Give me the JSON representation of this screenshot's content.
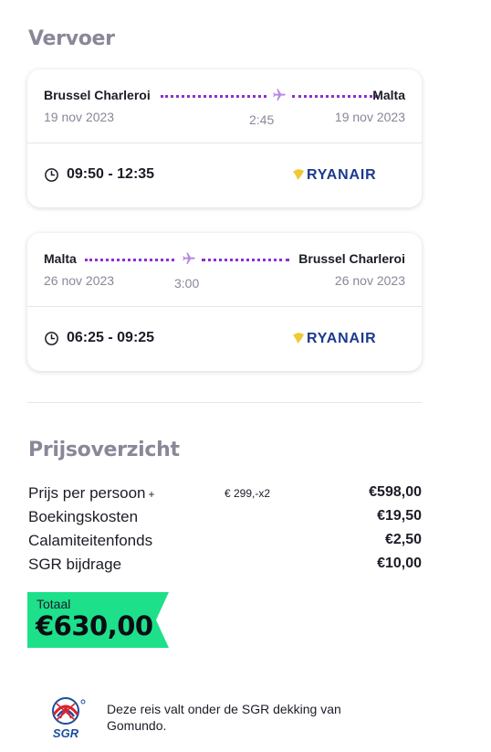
{
  "vervoer": {
    "title": "Vervoer",
    "flights": [
      {
        "from_city": "Brussel Charleroi",
        "to_city": "Malta",
        "from_date": "19 nov 2023",
        "to_date": "19 nov 2023",
        "duration": "2:45",
        "times": "09:50 - 12:35",
        "airline": "RYANAIR"
      },
      {
        "from_city": "Malta",
        "to_city": "Brussel Charleroi",
        "from_date": "26 nov 2023",
        "to_date": "26 nov 2023",
        "duration": "3:00",
        "times": "06:25 - 09:25",
        "airline": "RYANAIR"
      }
    ]
  },
  "prijsoverzicht": {
    "title": "Prijsoverzicht",
    "rows": [
      {
        "label": "Prijs per persoon",
        "expand_symbol": "+",
        "note": "€ 299,-x2",
        "value": "€598,00"
      },
      {
        "label": "Boekingskosten",
        "value": "€19,50"
      },
      {
        "label": "Calamiteitenfonds",
        "value": "€2,50"
      },
      {
        "label": "SGR bijdrage",
        "value": "€10,00"
      }
    ],
    "total_label": "Totaal",
    "total_value": "€630,00"
  },
  "sgr": {
    "logo_text": "SGR",
    "text": "Deze reis valt onder de SGR dekking van Gomundo."
  },
  "colors": {
    "accent_purple": "#8e2ecf",
    "muted_text": "#8a8798",
    "total_green": "#1ee08a",
    "ryanair_blue": "#1b3a8e",
    "ryanair_gold": "#f1c933"
  }
}
